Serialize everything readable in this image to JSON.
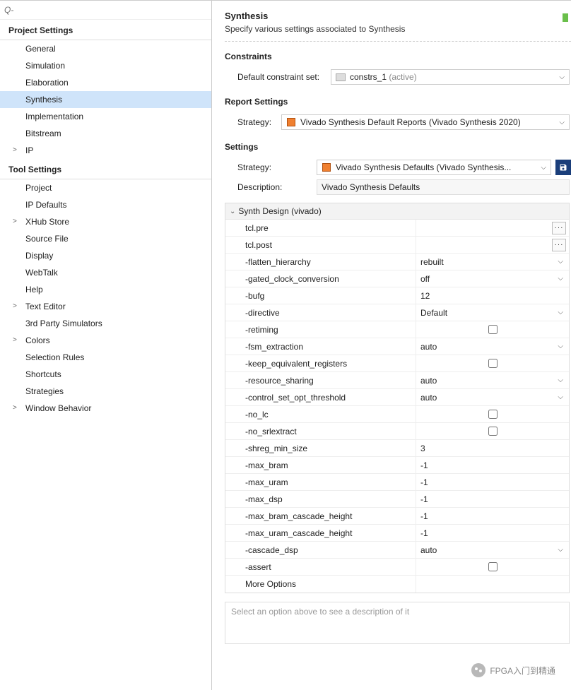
{
  "search": {
    "placeholder": "Q-"
  },
  "sidebar": {
    "sections": [
      {
        "title": "Project Settings",
        "items": [
          {
            "label": "General",
            "expandable": false
          },
          {
            "label": "Simulation",
            "expandable": false
          },
          {
            "label": "Elaboration",
            "expandable": false
          },
          {
            "label": "Synthesis",
            "expandable": false,
            "selected": true
          },
          {
            "label": "Implementation",
            "expandable": false
          },
          {
            "label": "Bitstream",
            "expandable": false
          },
          {
            "label": "IP",
            "expandable": true
          }
        ]
      },
      {
        "title": "Tool Settings",
        "items": [
          {
            "label": "Project",
            "expandable": false
          },
          {
            "label": "IP Defaults",
            "expandable": false
          },
          {
            "label": "XHub Store",
            "expandable": true
          },
          {
            "label": "Source File",
            "expandable": false
          },
          {
            "label": "Display",
            "expandable": false
          },
          {
            "label": "WebTalk",
            "expandable": false
          },
          {
            "label": "Help",
            "expandable": false
          },
          {
            "label": "Text Editor",
            "expandable": true
          },
          {
            "label": "3rd Party Simulators",
            "expandable": false
          },
          {
            "label": "Colors",
            "expandable": true
          },
          {
            "label": "Selection Rules",
            "expandable": false
          },
          {
            "label": "Shortcuts",
            "expandable": false
          },
          {
            "label": "Strategies",
            "expandable": false
          },
          {
            "label": "Window Behavior",
            "expandable": true
          }
        ]
      }
    ]
  },
  "main": {
    "title": "Synthesis",
    "subtitle": "Specify various settings associated to Synthesis",
    "constraints": {
      "section_label": "Constraints",
      "label": "Default constraint set:",
      "value": "constrs_1",
      "suffix": "(active)"
    },
    "report": {
      "section_label": "Report Settings",
      "label": "Strategy:",
      "value": "Vivado Synthesis Default Reports (Vivado Synthesis 2020)"
    },
    "settings": {
      "section_label": "Settings",
      "strategy_label": "Strategy:",
      "strategy_value": "Vivado Synthesis Defaults (Vivado Synthesis...",
      "description_label": "Description:",
      "description_value": "Vivado Synthesis Defaults",
      "group_header": "Synth Design (vivado)",
      "options": [
        {
          "name": "tcl.pre",
          "value": "",
          "control": "browse"
        },
        {
          "name": "tcl.post",
          "value": "",
          "control": "browse"
        },
        {
          "name": "-flatten_hierarchy",
          "value": "rebuilt",
          "control": "dropdown"
        },
        {
          "name": "-gated_clock_conversion",
          "value": "off",
          "control": "dropdown"
        },
        {
          "name": "-bufg",
          "value": "12",
          "control": "text"
        },
        {
          "name": "-directive",
          "value": "Default",
          "control": "dropdown"
        },
        {
          "name": "-retiming",
          "value": "",
          "control": "checkbox",
          "checked": false
        },
        {
          "name": "-fsm_extraction",
          "value": "auto",
          "control": "dropdown"
        },
        {
          "name": "-keep_equivalent_registers",
          "value": "",
          "control": "checkbox",
          "checked": false
        },
        {
          "name": "-resource_sharing",
          "value": "auto",
          "control": "dropdown"
        },
        {
          "name": "-control_set_opt_threshold",
          "value": "auto",
          "control": "dropdown"
        },
        {
          "name": "-no_lc",
          "value": "",
          "control": "checkbox",
          "checked": false
        },
        {
          "name": "-no_srlextract",
          "value": "",
          "control": "checkbox",
          "checked": false
        },
        {
          "name": "-shreg_min_size",
          "value": "3",
          "control": "text"
        },
        {
          "name": "-max_bram",
          "value": "-1",
          "control": "text"
        },
        {
          "name": "-max_uram",
          "value": "-1",
          "control": "text"
        },
        {
          "name": "-max_dsp",
          "value": "-1",
          "control": "text"
        },
        {
          "name": "-max_bram_cascade_height",
          "value": "-1",
          "control": "text"
        },
        {
          "name": "-max_uram_cascade_height",
          "value": "-1",
          "control": "text"
        },
        {
          "name": "-cascade_dsp",
          "value": "auto",
          "control": "dropdown"
        },
        {
          "name": "-assert",
          "value": "",
          "control": "checkbox",
          "checked": false
        },
        {
          "name": "More Options",
          "value": "",
          "control": "text"
        }
      ],
      "description_placeholder": "Select an option above to see a description of it"
    }
  },
  "watermark": "FPGA入门到精通"
}
